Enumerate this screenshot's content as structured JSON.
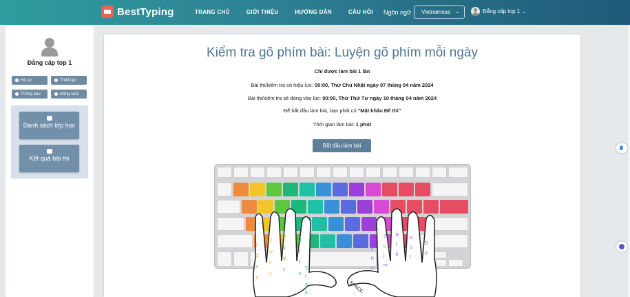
{
  "header": {
    "logo_text": "BestTyping",
    "nav": [
      "TRANG CHỦ",
      "GIỚI THIỆU",
      "HƯỚNG DẪN",
      "CÂU HỎI"
    ],
    "language_label": "Ngôn ngữ",
    "language_value": "Vietnamese",
    "user_name": "Đẳng cấp top 1"
  },
  "sidebar": {
    "user_name": "Đẳng cấp top 1",
    "buttons": {
      "profile": "Hồ sơ",
      "settings": "Thiết lập",
      "notifications": "Thông báo",
      "logout": "Đăng xuất"
    },
    "class_list": "Danh sách lớp học",
    "results": "Kết quả bài thi"
  },
  "main": {
    "title": "Kiểm tra gõ phím bài: Luyện gõ phím mỗi ngày",
    "once_notice": "Chỉ được làm bài 1 lần",
    "valid_prefix": "Bài thi/kiểm tra có hiệu lực: ",
    "valid_value": "00:00, Thứ Chủ Nhật ngày 07 tháng 04 năm 2024",
    "close_prefix": "Bài thi/kiểm tra sẽ đóng vào lúc: ",
    "close_value": "00:00, Thứ Thứ Tư ngày 10 tháng 04 năm 2024",
    "password_prefix": "Để bắt đầu làm bài, bạn phải có ",
    "password_value": "\"Mật khẩu Đề thi\"",
    "duration_prefix": "Thời gian làm bài: ",
    "duration_value": "1 phút",
    "start_button": "Bắt đầu làm bài"
  },
  "keyboard": {
    "space_label": "SPACE",
    "left_hand_letters": [
      "1",
      "q",
      "a",
      "z",
      "2",
      "w",
      "s",
      "x",
      "3",
      "e",
      "d",
      "c",
      "4",
      "r",
      "f",
      "v",
      "5",
      "t",
      "g",
      "b"
    ],
    "right_hand_letters": [
      "6",
      "y",
      "h",
      "n",
      "7",
      "u",
      "j",
      "m",
      "8",
      "i",
      "k",
      "9",
      "o",
      "l",
      "0",
      "p"
    ],
    "colors": {
      "pinky": "#f08a3c",
      "ring": "#f4c52a",
      "middle": "#5cc83f",
      "index_l": "#1fb77a",
      "index_l2": "#20c0a6",
      "index_r": "#3a8fd9",
      "index_r2": "#5a6be0",
      "middle_r": "#9b3fd8",
      "ring_r": "#d84ad6",
      "pinky_r": "#e64d63"
    }
  }
}
